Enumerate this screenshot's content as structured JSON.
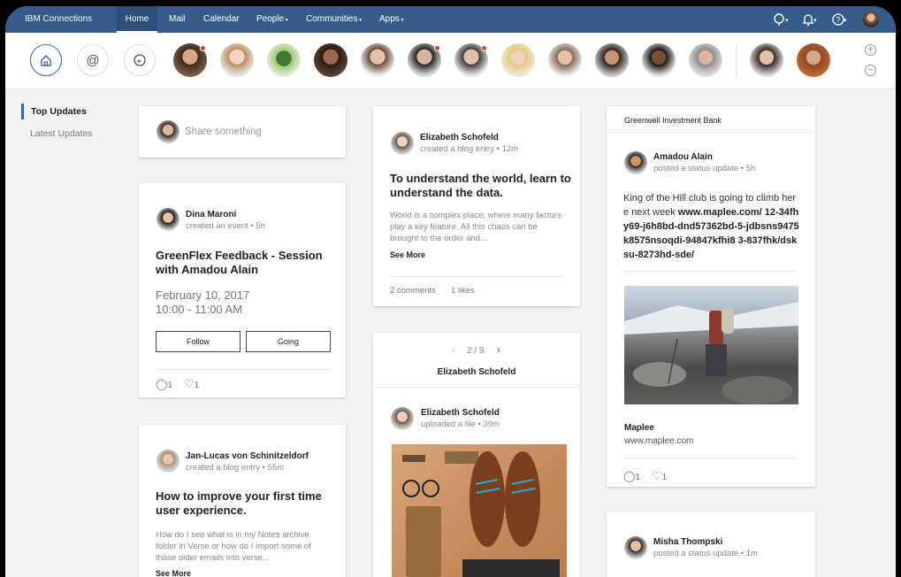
{
  "app": {
    "brand": "IBM Connections"
  },
  "nav": {
    "home": "Home",
    "mail": "Mail",
    "calendar": "Calendar",
    "people": "People",
    "communities": "Communities",
    "apps": "Apps"
  },
  "sidebar": {
    "items": [
      {
        "label": "Top Updates"
      },
      {
        "label": "Latest Updates"
      }
    ]
  },
  "share": {
    "placeholder": "Share something"
  },
  "colors": {
    "nav": "#365c8b",
    "accent": "#3a66a8",
    "badge": "#e03b3b"
  },
  "cards": {
    "dina": {
      "name": "Dina Maroni",
      "meta": "created an event • 5h",
      "title": "GreenFlex Feedback - Session with Amadou Alain",
      "date": "February 10, 2017",
      "time": "10:00 - 11:00 AM",
      "follow": "Follow",
      "going": "Going",
      "comments": "1",
      "likes": "1"
    },
    "janlucas": {
      "name": "Jan-Lucas von Schinitzeldorf",
      "meta": "created a blog entry • 55m",
      "title": "How to improve your first time user experience.",
      "body": "How do I see what is in my Notes archive folder in Verse or how do I import some of those older emails into verse...",
      "see_more": "See More"
    },
    "eliz1": {
      "name": "Elizabeth Schofeld",
      "meta": "created a blog entry • 12m",
      "title": "To understand the world, learn to understand the data.",
      "body": "World is a complex place, where many factors play a key feature. All this chaos can be brought to the order and...",
      "see_more": "See More",
      "comments": "2 comments",
      "likes": "1 likes"
    },
    "eliz2": {
      "pager": "2 / 9",
      "header": "Elizabeth Schofeld",
      "name": "Elizabeth Schofeld",
      "meta": "uploaded a file • 39m"
    },
    "amadou": {
      "header": "Greenwell Investment Bank",
      "name": "Amadou Alain",
      "meta": "posted a status update • 5h",
      "text1": "King of the Hill club is going to climb here next week ",
      "link": "www.maplee.com/ 12-34fhy69-j6h8bd-dnd57362bd-5-jdbsns9475k8575nsoqdi-94847kfhi8 3-837fhk/dsksu-8273hd-sde/",
      "site_title": "Maplee",
      "site_url": "www.maplee.com",
      "comments": "1",
      "likes": "1"
    },
    "misha": {
      "name": "Misha Thompski",
      "meta": "posted a status update • 1m"
    }
  }
}
